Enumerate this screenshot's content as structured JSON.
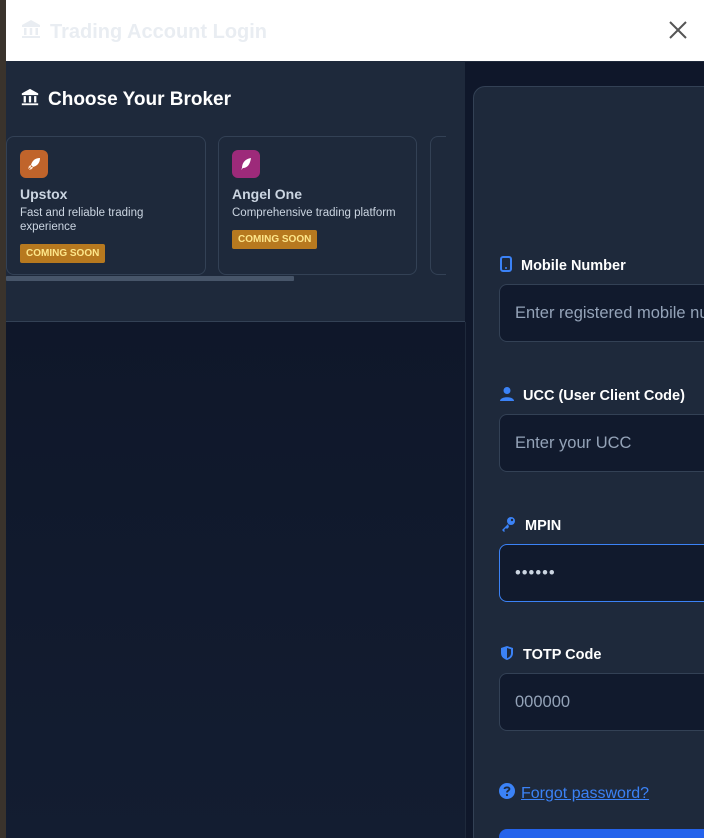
{
  "modal": {
    "title": "Trading Account Login"
  },
  "brokers_section": {
    "title": "Choose Your Broker",
    "brokers": [
      {
        "name": "Upstox",
        "description": "Fast and reliable trading experience",
        "badge": "COMING SOON",
        "icon": "rocket-icon",
        "icon_color": "#c0642b"
      },
      {
        "name": "Angel One",
        "description": "Comprehensive trading platform",
        "badge": "COMING SOON",
        "icon": "feather-icon",
        "icon_color": "#9d2a7a"
      }
    ]
  },
  "login_form": {
    "mobile": {
      "label": "Mobile Number",
      "placeholder": "Enter registered mobile number",
      "icon": "phone-icon"
    },
    "ucc": {
      "label": "UCC (User Client Code)",
      "placeholder": "Enter your UCC",
      "icon": "user-icon"
    },
    "mpin": {
      "label": "MPIN",
      "value": "••••••",
      "icon": "key-icon"
    },
    "totp": {
      "label": "TOTP Code",
      "placeholder": "000000",
      "icon": "shield-icon"
    },
    "forgot_label": "Forgot password?"
  },
  "colors": {
    "accent": "#3b82f6",
    "badge": "#b7791f",
    "panel": "#1e293b",
    "background": "#0f172a"
  }
}
